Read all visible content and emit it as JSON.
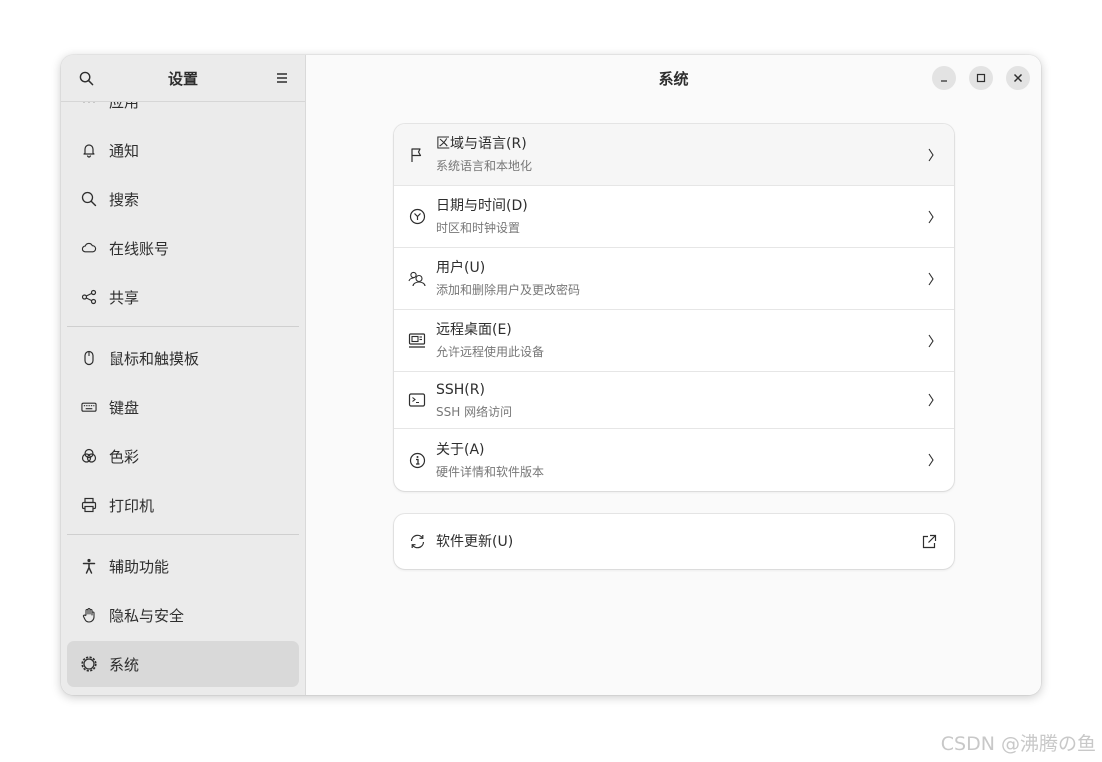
{
  "sidebar": {
    "title": "设置",
    "items": [
      {
        "label": "应用",
        "icon": "apps-icon"
      },
      {
        "label": "通知",
        "icon": "bell-icon"
      },
      {
        "label": "搜索",
        "icon": "search-icon"
      },
      {
        "label": "在线账号",
        "icon": "cloud-icon"
      },
      {
        "label": "共享",
        "icon": "share-icon"
      },
      {
        "label": "鼠标和触摸板",
        "icon": "mouse-icon"
      },
      {
        "label": "键盘",
        "icon": "keyboard-icon"
      },
      {
        "label": "色彩",
        "icon": "color-icon"
      },
      {
        "label": "打印机",
        "icon": "printer-icon"
      },
      {
        "label": "辅助功能",
        "icon": "accessibility-icon"
      },
      {
        "label": "隐私与安全",
        "icon": "hand-icon"
      },
      {
        "label": "系统",
        "icon": "gear-icon"
      }
    ]
  },
  "main": {
    "title": "系统",
    "rows": [
      {
        "title": "区域与语言(R)",
        "subtitle": "系统语言和本地化",
        "icon": "flag-icon"
      },
      {
        "title": "日期与时间(D)",
        "subtitle": "时区和时钟设置",
        "icon": "clock-icon"
      },
      {
        "title": "用户(U)",
        "subtitle": "添加和删除用户及更改密码",
        "icon": "users-icon"
      },
      {
        "title": "远程桌面(E)",
        "subtitle": "允许远程使用此设备",
        "icon": "remote-desktop-icon"
      },
      {
        "title": "SSH(R)",
        "subtitle": "SSH 网络访问",
        "icon": "terminal-icon"
      },
      {
        "title": "关于(A)",
        "subtitle": "硬件详情和软件版本",
        "icon": "info-icon"
      }
    ],
    "update": {
      "title": "软件更新(U)",
      "icon": "refresh-icon"
    }
  },
  "watermark": "CSDN @沸腾の鱼"
}
